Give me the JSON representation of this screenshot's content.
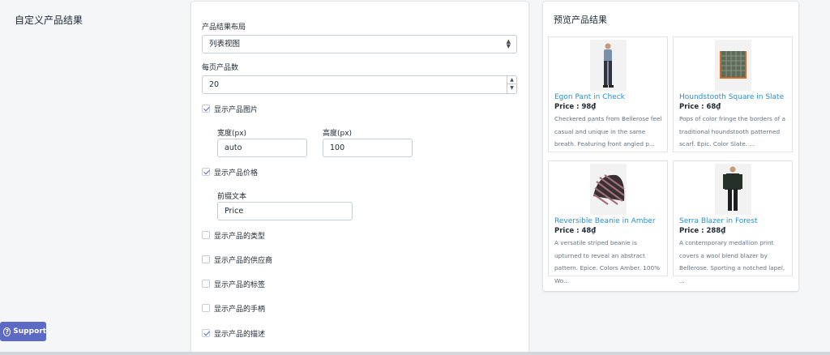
{
  "section": {
    "title": "自定义产品结果"
  },
  "settings": {
    "layout_label": "产品结果布局",
    "layout_value": "列表视图",
    "per_page_label": "每页产品数",
    "per_page_value": "20",
    "show_image": {
      "label": "显示产品图片",
      "checked": true
    },
    "width_label": "宽度(px)",
    "width_value": "auto",
    "height_label": "高度(px)",
    "height_value": "100",
    "show_price": {
      "label": "显示产品价格",
      "checked": true
    },
    "prefix_label": "前缀文本",
    "prefix_value": "Price",
    "show_type": {
      "label": "显示产品的类型",
      "checked": false
    },
    "show_vendor": {
      "label": "显示产品的供应商",
      "checked": false
    },
    "show_tags": {
      "label": "显示产品的标签",
      "checked": false
    },
    "show_handle": {
      "label": "显示产品的手柄",
      "checked": false
    },
    "show_desc": {
      "label": "显示产品的描述",
      "checked": true
    }
  },
  "preview": {
    "title": "预览产品结果",
    "products": [
      {
        "name": "Egon Pant in Check",
        "price": "Price : 98₫",
        "desc": "Checkered pants from Bellerose feel casual and unique in the same breath. Featuring front angled p...",
        "icon": "pants-photo"
      },
      {
        "name": "Houndstooth Square in Slate",
        "price": "Price : 68₫",
        "desc": "Pops of color fringe the borders of a traditional houndstooth patterned scarf. Epic. Color Slate. ...",
        "icon": "scarf-photo"
      },
      {
        "name": "Reversible Beanie in Amber",
        "price": "Price : 48₫",
        "desc": "A versatile striped beanie is upturned to reveal an abstract pattern. Epice. Colors Amber. 100% Wo...",
        "icon": "beanie-photo"
      },
      {
        "name": "Serra Blazer in Forest",
        "price": "Price : 288₫",
        "desc": "A contemporary medallion print covers a wool blend blazer by Bellerose. Sporting a notched lapel, ...",
        "icon": "blazer-photo"
      }
    ]
  },
  "support": {
    "label": "Support"
  },
  "colors": {
    "accent": "#5c6ac4",
    "link": "#2a8fd0"
  }
}
